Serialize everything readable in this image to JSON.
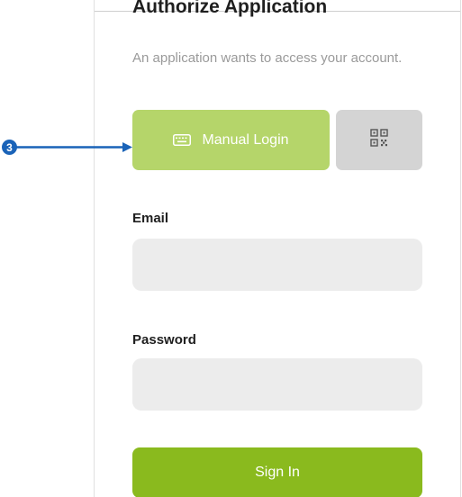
{
  "auth": {
    "title": "Authorize Application",
    "subtitle": "An application wants to access your account.",
    "manual_login_label": "Manual Login",
    "manual_login_icon": "keyboard-icon",
    "qr_login_icon": "qr-code-icon",
    "email_label": "Email",
    "email_value": "",
    "password_label": "Password",
    "password_value": "",
    "sign_in_label": "Sign In"
  },
  "annotation": {
    "step_number": "3",
    "arrow_color": "#1a63b8"
  },
  "colors": {
    "manual_login_bg": "#b5d56a",
    "qr_button_bg": "#d4d4d4",
    "sign_in_bg": "#8aba1e",
    "input_bg": "#ececec"
  }
}
